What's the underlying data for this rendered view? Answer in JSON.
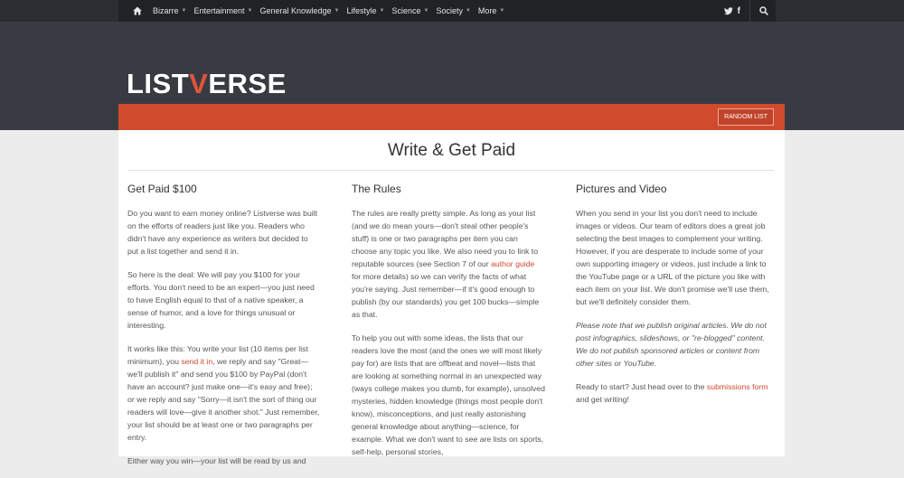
{
  "nav": {
    "items": [
      {
        "label": "Bizarre"
      },
      {
        "label": "Entertainment"
      },
      {
        "label": "General Knowledge"
      },
      {
        "label": "Lifestyle"
      },
      {
        "label": "Science"
      },
      {
        "label": "Society"
      },
      {
        "label": "More"
      }
    ],
    "caret": "▼",
    "twitter": "🐦",
    "facebook": "f"
  },
  "logo": {
    "part1": "LIST",
    "v": "V",
    "part2": "ERSE"
  },
  "toolbar": {
    "random_label": "RANDOM LIST"
  },
  "page": {
    "title": "Write & Get Paid"
  },
  "col1": {
    "heading": "Get Paid $100",
    "p1": "Do you want to earn money online? Listverse was built on the efforts of readers just like you. Readers who didn't have any experience as writers but decided to put a list together and send it in.",
    "p2": "So here is the deal: We will pay you $100 for your efforts. You don't need to be an expert—you just need to have English equal to that of a native speaker, a sense of humor, and a love for things unusual or interesting.",
    "p3_a": "It works like this: You write your list (10 items per list minimum), you ",
    "p3_link": "send it in",
    "p3_b": ", we reply and say \"Great—we'll publish it\" and send you $100 by PayPal (don't have an account? just make one—it's easy and free); or we reply and say \"Sorry—it isn't the sort of thing our readers will love—give it another shot.\" Just remember, your list should be at least one or two paragraphs per entry.",
    "p4": "Either way you win—your list will be read by us and"
  },
  "col2": {
    "heading": "The Rules",
    "p1_a": "The rules are really pretty simple. As long as your list (and we do mean yours—don't steal other people's stuff) is one or two paragraphs per item you can choose any topic you like. We also need you to link to reputable sources (see Section 7 of our ",
    "p1_link": "author guide",
    "p1_b": " for more details) so we can verify the facts of what you're saying. Just remember—if it's good enough to publish (by our standards) you get 100 bucks—simple as that.",
    "p2": "To help you out with some ideas, the lists that our readers love the most (and the ones we will most likely pay for) are lists that are offbeat and novel—lists that are looking at something normal in an unexpected way (ways college makes you dumb, for example), unsolved mysteries, hidden knowledge (things most people don't know), misconceptions, and just really astonishing general knowledge about anything—science, for example. What we don't want to see are lists on sports, self-help, personal stories,"
  },
  "col3": {
    "heading": "Pictures and Video",
    "p1": "When you send in your list you don't need to include images or videos. Our team of editors does a great job selecting the best images to complement your writing. However, if you are desperate to include some of your own supporting imagery or videos, just include a link to the YouTube page or a URL of the picture you like with each item on your list. We don't promise we'll use them, but we'll definitely consider them.",
    "p2": "Please note that we publish original articles. We do not post infographics, slideshows, or \"re-blogged\" content. We do not publish sponsored articles or content from other sites or YouTube.",
    "p3_a": "Ready to start? Just head over to the ",
    "p3_link": "submissions form",
    "p3_b": " and get writing!"
  },
  "colors": {
    "accent": "#d04a2e",
    "header_bg": "#393b43",
    "topbar_bg": "#202226"
  }
}
